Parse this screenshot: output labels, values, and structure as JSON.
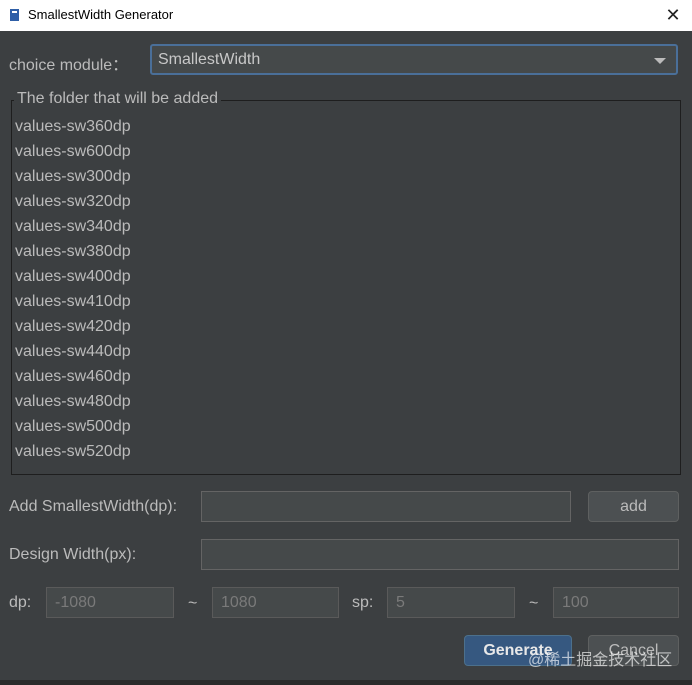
{
  "window": {
    "title": "SmallestWidth Generator",
    "close_glyph": "✕"
  },
  "module": {
    "label": "choice module：",
    "selected": "SmallestWidth"
  },
  "folders": {
    "title": "The folder that will be added",
    "items": [
      "values-sw360dp",
      "values-sw600dp",
      "values-sw300dp",
      "values-sw320dp",
      "values-sw340dp",
      "values-sw380dp",
      "values-sw400dp",
      "values-sw410dp",
      "values-sw420dp",
      "values-sw440dp",
      "values-sw460dp",
      "values-sw480dp",
      "values-sw500dp",
      "values-sw520dp"
    ]
  },
  "add_sw": {
    "label": "Add SmallestWidth(dp):",
    "value": "",
    "button": "add"
  },
  "design_width": {
    "label": "Design Width(px):",
    "value": ""
  },
  "ranges": {
    "dp_label": "dp:",
    "dp_min": "-1080",
    "dp_max": "1080",
    "sp_label": "sp:",
    "sp_min": "5",
    "sp_max": "100",
    "separator": "~"
  },
  "actions": {
    "generate": "Generate",
    "cancel": "Cancel"
  },
  "watermark": "@稀土掘金技术社区",
  "colors": {
    "background": "#3c3f41",
    "accent": "#365880",
    "text": "#bbbbbb"
  }
}
